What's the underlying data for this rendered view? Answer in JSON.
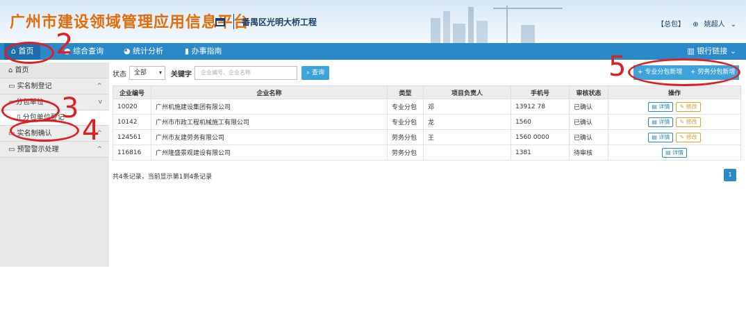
{
  "header": {
    "title": "广州市建设领域管理应用信息平台",
    "project": "番禺区光明大桥工程",
    "role": "【总包】",
    "user": "姚超人"
  },
  "nav": {
    "items": [
      {
        "label": "首页",
        "icon": "home-icon"
      },
      {
        "label": "综合查询",
        "icon": "search-icon"
      },
      {
        "label": "统计分析",
        "icon": "chart-icon"
      },
      {
        "label": "办事指南",
        "icon": "book-icon"
      }
    ],
    "bank": "银行链接"
  },
  "sidebar": {
    "home": "首页",
    "items": [
      {
        "label": "实名制登记",
        "arrow": "^"
      },
      {
        "label": "分包单位",
        "arrow": "v"
      },
      {
        "label": "分包单位登记",
        "arrow": ""
      },
      {
        "label": "实名制确认",
        "arrow": "^"
      },
      {
        "label": "预警警示处理",
        "arrow": "^"
      }
    ]
  },
  "filter": {
    "status_label": "状态",
    "status_value": "全部",
    "keyword_label": "关键字",
    "keyword_placeholder": "企业编号、企业名称",
    "query_label": "查询",
    "add_pro": "专业分包新增",
    "add_labor": "劳务分包新增"
  },
  "table": {
    "headers": [
      "企业编号",
      "企业名称",
      "类型",
      "项目负责人",
      "手机号",
      "审核状态",
      "操作"
    ],
    "rows": [
      [
        "10020",
        "广州机施建设集团有限公司",
        "专业分包",
        "邓",
        "13912  78",
        "已确认"
      ],
      [
        "10142",
        "广州市市政工程机械施工有限公司",
        "专业分包",
        "龙",
        "1560",
        "已确认"
      ],
      [
        "124561",
        "广州市友建劳务有限公司",
        "劳务分包",
        "王",
        "1560  0000",
        "已确认"
      ],
      [
        "116816",
        "广州隆盛景观建设有限公司",
        "劳务分包",
        "",
        "1381",
        "待审核"
      ]
    ],
    "view_label": "详情",
    "edit_label": "修改"
  },
  "footer": {
    "summary": "共4条记录，当前显示第1到4条记录",
    "page": "1"
  },
  "annotations": [
    "2",
    "3",
    "4",
    "5"
  ]
}
